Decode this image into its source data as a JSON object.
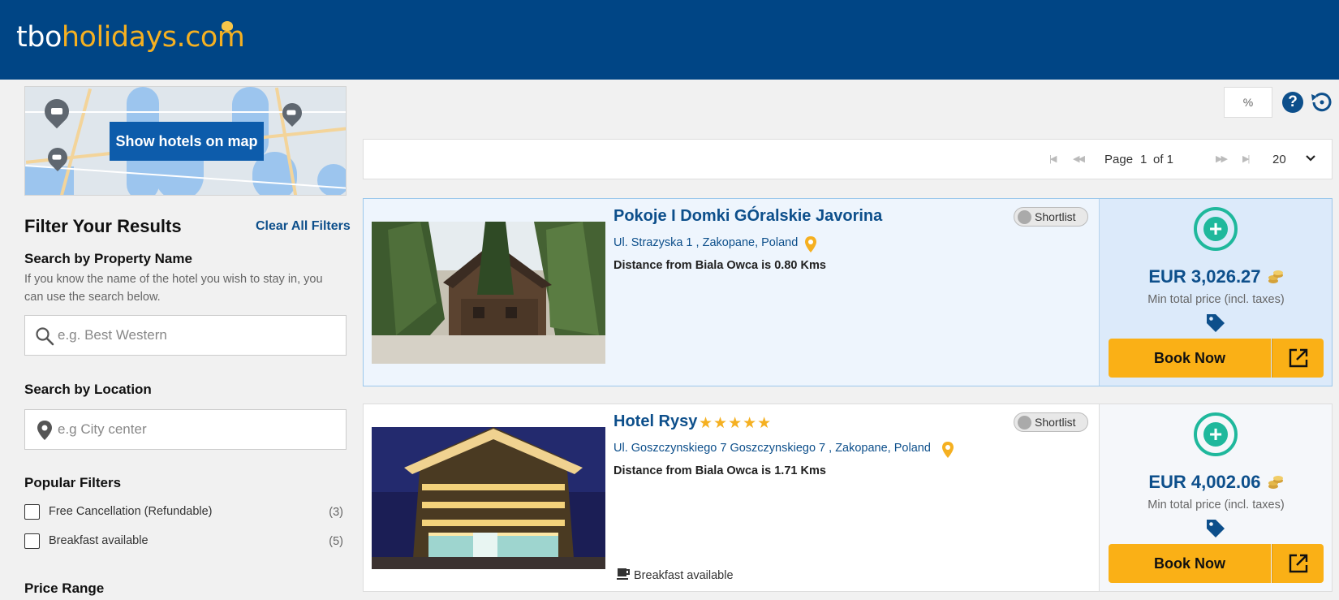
{
  "header": {
    "logo_part1": "tbo",
    "logo_part2": "holidays.com"
  },
  "map": {
    "button_label": "Show hotels on map"
  },
  "filters": {
    "title": "Filter Your Results",
    "clear_label": "Clear All Filters",
    "property_search": {
      "title": "Search by Property Name",
      "help": "If you know the name of the hotel you wish to stay in, you can use the search below.",
      "placeholder": "e.g. Best Western"
    },
    "location_search": {
      "title": "Search by Location",
      "placeholder": "e.g City center"
    },
    "popular": {
      "title": "Popular Filters",
      "items": [
        {
          "label": "Free Cancellation (Refundable)",
          "count": "(3)"
        },
        {
          "label": "Breakfast available",
          "count": "(5)"
        }
      ]
    },
    "price_range_title": "Price Range"
  },
  "toolbar": {
    "percent_label": "%",
    "help_label": "?"
  },
  "pager": {
    "page_label": "Page",
    "page_number": "1",
    "of_label": "of 1",
    "page_size": "20"
  },
  "hotels": [
    {
      "name": "Pokoje I Domki GÓralskie Javorina",
      "stars": "",
      "address": "Ul. Strazyska 1 , Zakopane, Poland",
      "distance": "Distance from Biala Owca is 0.80 Kms",
      "shortlist": "Shortlist",
      "amenity": "",
      "price": "EUR 3,026.27",
      "price_note": "Min total price (incl. taxes)",
      "book_label": "Book Now"
    },
    {
      "name": "Hotel Rysy",
      "stars": "★★★★★",
      "address": "Ul. Goszczynskiego 7 Goszczynskiego 7 , Zakopane, Poland",
      "distance": "Distance from Biala Owca is 1.71 Kms",
      "shortlist": "Shortlist",
      "amenity": "Breakfast available",
      "price": "EUR 4,002.06",
      "price_note": "Min total price (incl. taxes)",
      "book_label": "Book Now"
    }
  ],
  "colors": {
    "brand_blue": "#004585",
    "accent_gold": "#f5b021",
    "book_yellow": "#fab016",
    "teal": "#1fb89c"
  }
}
